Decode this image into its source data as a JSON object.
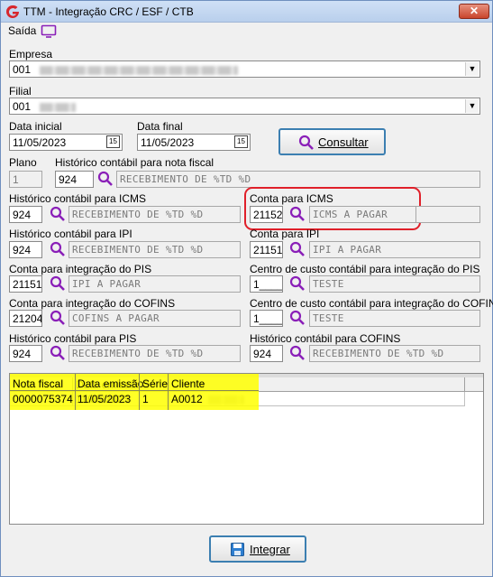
{
  "window": {
    "title": "TTM - Integração CRC / ESF / CTB",
    "close_label": "✕"
  },
  "menu": {
    "saida": "Saída"
  },
  "empresa": {
    "label": "Empresa",
    "value": "001"
  },
  "filial": {
    "label": "Filial",
    "value": "001"
  },
  "data_inicial": {
    "label": "Data inicial",
    "value": "11/05/2023"
  },
  "data_final": {
    "label": "Data final",
    "value": "11/05/2023"
  },
  "calendar_label": "15",
  "consultar_label": "Consultar",
  "plano": {
    "label": "Plano",
    "value": "1"
  },
  "historico_nota": {
    "label": "Histórico contábil para nota fiscal",
    "code": "924",
    "desc": "RECEBIMENTO DE %TD %D"
  },
  "historico_icms": {
    "label": "Histórico contábil para ICMS",
    "code": "924",
    "desc": "RECEBIMENTO DE %TD %D"
  },
  "conta_icms": {
    "label": "Conta para ICMS",
    "code": "21152",
    "desc": "ICMS A PAGAR"
  },
  "historico_ipi": {
    "label": "Histórico contábil para IPI",
    "code": "924",
    "desc": "RECEBIMENTO DE %TD %D"
  },
  "conta_ipi": {
    "label": "Conta para IPI",
    "code": "21151",
    "desc": "IPI A PAGAR"
  },
  "conta_pis": {
    "label": "Conta para integração do PIS",
    "code": "21151",
    "desc": "IPI A PAGAR"
  },
  "centro_pis": {
    "label": "Centro de custo contábil para integração do PIS",
    "code": "1____",
    "desc": "TESTE"
  },
  "conta_cofins": {
    "label": "Conta para integração do COFINS",
    "code": "21204",
    "desc": "COFINS A PAGAR"
  },
  "centro_cofins": {
    "label": "Centro de custo contábil para integração do COFINS",
    "code": "1____",
    "desc": "TESTE"
  },
  "historico_pis": {
    "label": "Histórico contábil para PIS",
    "code": "924",
    "desc": "RECEBIMENTO DE %TD %D"
  },
  "historico_cofins": {
    "label": "Histórico contábil para COFINS",
    "code": "924",
    "desc": "RECEBIMENTO DE %TD %D"
  },
  "grid": {
    "headers": [
      "Nota fiscal",
      "Data emissão",
      "Série",
      "Cliente"
    ],
    "rows": [
      {
        "nota": "0000075374",
        "data": "11/05/2023",
        "serie": "1",
        "cliente": "A0012"
      }
    ]
  },
  "integrar_label": "Integrar",
  "colors": {
    "highlight_red": "#e0202a",
    "highlight_yellow": "#ffff00",
    "search_purple": "#8a1fb8"
  }
}
